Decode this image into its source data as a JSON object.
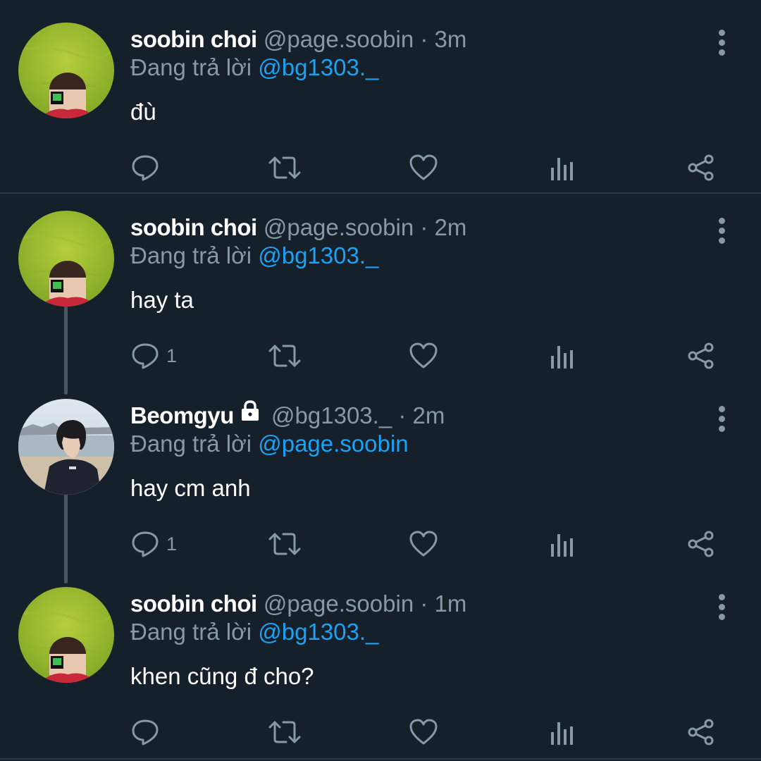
{
  "colors": {
    "background": "#15202b",
    "secondary_text": "#8899a6",
    "mention": "#1da1f2",
    "divider": "#2c3640"
  },
  "reply_prefix": "Đang trả lời",
  "tweets": [
    {
      "name": "soobin choi",
      "handle": "@page.soobin",
      "time": "· 3m",
      "reply_to": "@bg1303._",
      "text": "đù",
      "reply_count": "",
      "locked": false,
      "avatar": "grass-camera-avatar"
    },
    {
      "name": "soobin choi",
      "handle": "@page.soobin",
      "time": "· 2m",
      "reply_to": "@bg1303._",
      "text": "hay ta",
      "reply_count": "1",
      "locked": false,
      "avatar": "grass-camera-avatar"
    },
    {
      "name": "Beomgyu",
      "handle": "@bg1303._",
      "time": "· 2m",
      "reply_to": "@page.soobin",
      "text": "hay cm anh",
      "reply_count": "1",
      "locked": true,
      "avatar": "beach-profile-avatar"
    },
    {
      "name": "soobin choi",
      "handle": "@page.soobin",
      "time": "· 1m",
      "reply_to": "@bg1303._",
      "text": "khen cũng đ cho?",
      "reply_count": "",
      "locked": false,
      "avatar": "grass-camera-avatar"
    }
  ],
  "icons": [
    "reply-icon",
    "retweet-icon",
    "like-icon",
    "views-icon",
    "share-icon",
    "more-options-icon",
    "lock-icon"
  ]
}
